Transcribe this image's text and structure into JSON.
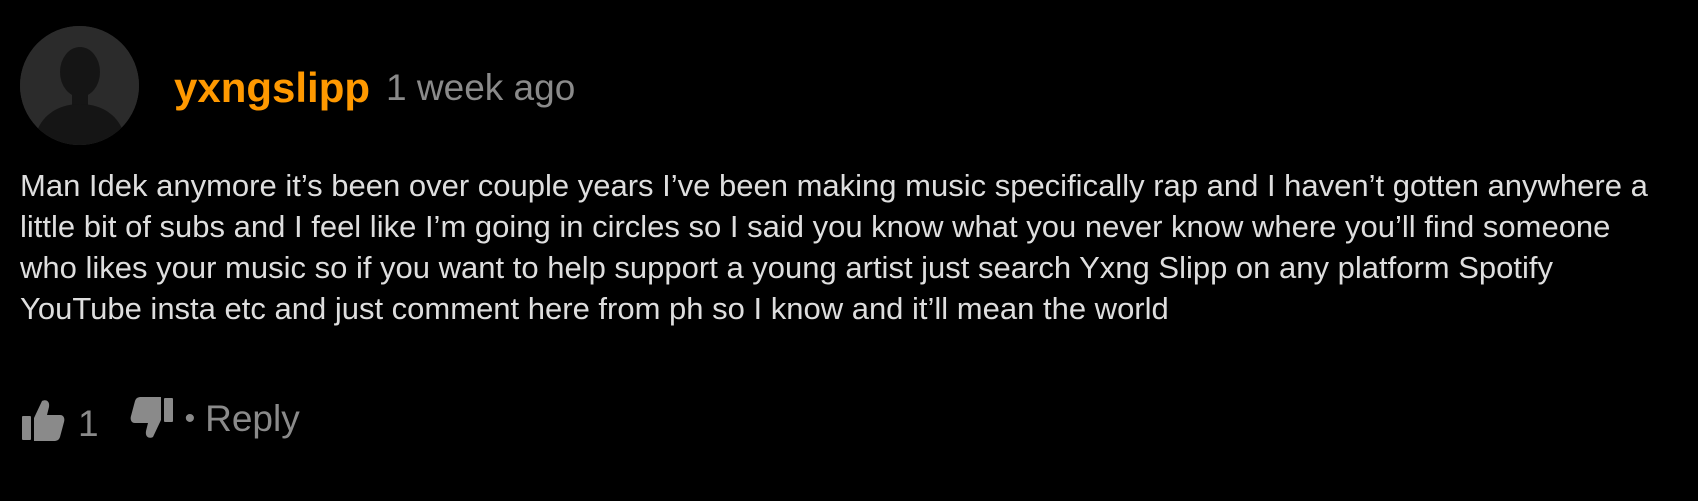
{
  "comment": {
    "username": "yxngslipp",
    "timestamp": "1 week ago",
    "body": "Man Idek anymore it’s been over couple years I’ve been making music specifically rap and I haven’t gotten anywhere a little bit of subs and I feel like I’m going in circles so I said you know what you never know where you’ll find someone who likes your music so if you want to help support a young artist just search Yxng Slipp on any platform Spotify YouTube insta etc and just comment here from ph so I know and it’ll mean the world",
    "like_count": "1",
    "separator": "•",
    "reply_label": "Reply"
  },
  "icons": {
    "avatar": "default-user-avatar-icon",
    "like": "thumbs-up-icon",
    "dislike": "thumbs-down-icon"
  },
  "colors": {
    "background": "#000000",
    "username": "#ff9900",
    "muted": "#8a8a8a",
    "text": "#dedede",
    "avatar_bg": "#2b2b2b",
    "avatar_silhouette": "#151515"
  }
}
